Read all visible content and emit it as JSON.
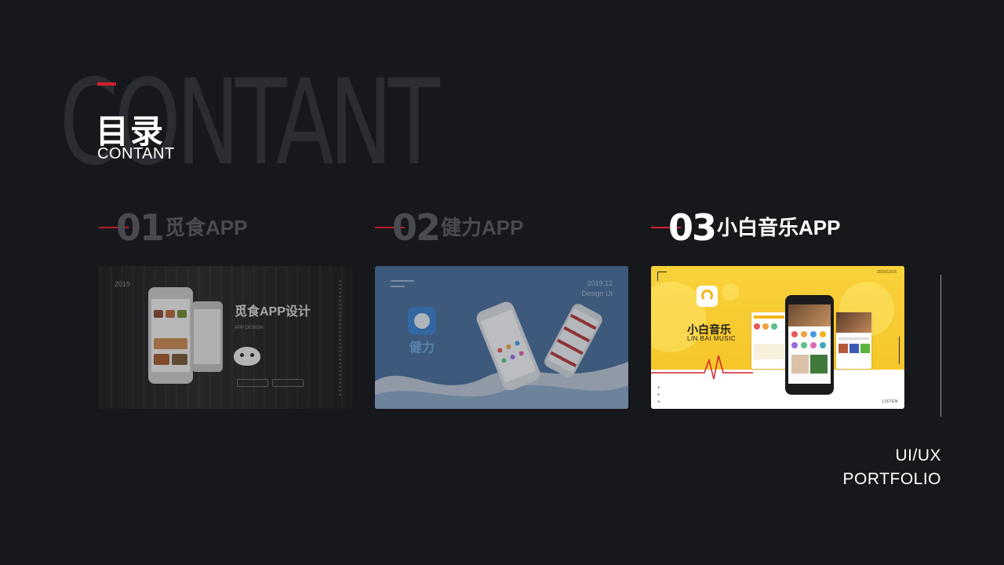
{
  "background_word": "CONTANT",
  "heading": {
    "title": "目录",
    "subtitle": "CONTANT"
  },
  "sections": [
    {
      "number": "01",
      "title": "觅食APP",
      "active": false
    },
    {
      "number": "02",
      "title": "健力APP",
      "active": false
    },
    {
      "number": "03",
      "title": "小白音乐APP",
      "active": true
    }
  ],
  "cards": {
    "food": {
      "year": "2019",
      "title": "觅食APP设计",
      "subtitle": "APP DESIGN"
    },
    "fitness": {
      "date": "2019.12",
      "date_sub": "Design UI",
      "brand": "健力"
    },
    "music": {
      "date": "2019/12/15",
      "name": "小白音乐",
      "name_en": "LIN BAI MUSIC",
      "side_label": "LISTEN"
    }
  },
  "tagline": {
    "line1": "UI/UX",
    "line2": "PORTFOLIO"
  },
  "colors": {
    "background": "#17181c",
    "accent": "#d4202e",
    "inactive_text": "#4a4b50",
    "music_yellow": "#f8d13a",
    "fitness_blue": "#4a6f9b"
  }
}
